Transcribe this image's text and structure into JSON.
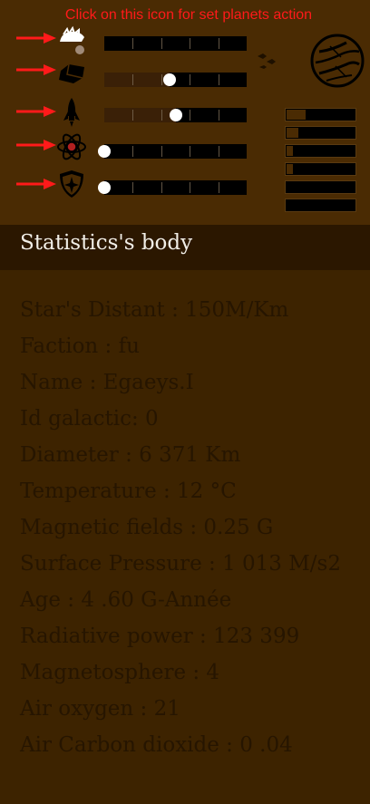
{
  "hint_text": "Click on this icon for set planets action",
  "actions": [
    {
      "icon": "colonize-icon",
      "level": 0.0
    },
    {
      "icon": "mining-cart-icon",
      "level": 0.46
    },
    {
      "icon": "rocket-icon",
      "level": 0.5
    },
    {
      "icon": "atom-icon",
      "level": 0.0
    },
    {
      "icon": "defense-shield-icon",
      "level": 0.0
    }
  ],
  "resources": [
    0.3,
    0.2,
    0.12,
    0.12,
    0.0,
    0.0
  ],
  "planet_icon": "planet-icon",
  "statistics": {
    "title": "Statistics's body",
    "lines": [
      "Star's Distant : 150M/Km",
      "Faction : fu",
      "Name : Egaeys.I",
      "Id galactic: 0",
      "Diameter : 6 371 Km",
      "Temperature : 12 °C",
      "Magnetic fields : 0.25 G",
      "Surface Pressure : 1 013 M/s2",
      "Age : 4 .60 G-Année",
      "Radiative power : 123 399",
      "Magnetosphere : 4",
      "Air oxygen : 21",
      "Air Carbon dioxide : 0 .04"
    ]
  },
  "colors": {
    "background": "#3d2300",
    "panel": "#4a2b03",
    "header": "#2b1700",
    "hint": "#ff1a1a",
    "stat_text": "#261500"
  }
}
